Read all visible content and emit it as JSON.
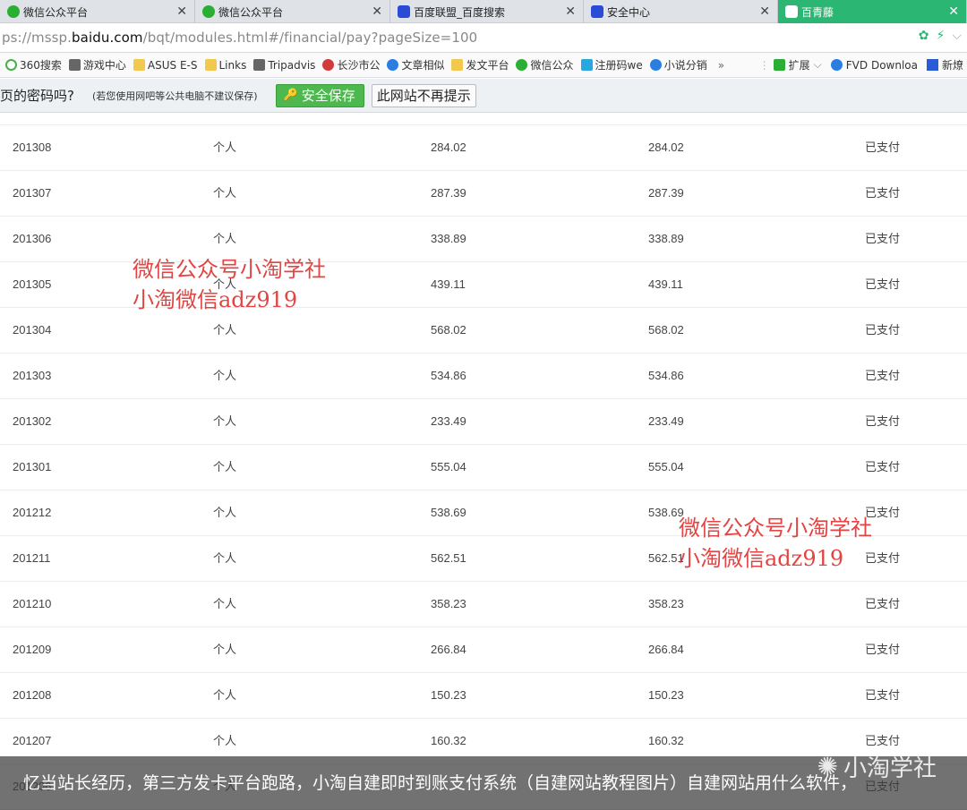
{
  "tabs": [
    {
      "label": "微信公众平台",
      "icon": "wechat-icon",
      "active": false
    },
    {
      "label": "微信公众平台",
      "icon": "wechat-icon",
      "active": false
    },
    {
      "label": "百度联盟_百度搜索",
      "icon": "baidu-paw-icon",
      "active": false
    },
    {
      "label": "安全中心",
      "icon": "baidu-paw-icon",
      "active": false
    },
    {
      "label": "百青藤",
      "icon": "baidu-paw-icon",
      "active": true
    }
  ],
  "address": {
    "prefix": "ps://mssp.",
    "domain": "baidu.com",
    "path": "/bqt/modules.html#/financial/pay?pageSize=100"
  },
  "bookmarks": [
    {
      "label": "360搜索",
      "icon": "ring"
    },
    {
      "label": "游戏中心",
      "icon": "gray"
    },
    {
      "label": "ASUS E-S",
      "icon": "folder"
    },
    {
      "label": "Links",
      "icon": "folder"
    },
    {
      "label": "Tripadvis",
      "icon": "gray"
    },
    {
      "label": "长沙市公",
      "icon": "red"
    },
    {
      "label": "文章相似",
      "icon": "blue"
    },
    {
      "label": "发文平台",
      "icon": "folder"
    },
    {
      "label": "微信公众",
      "icon": "green"
    },
    {
      "label": "注册码we",
      "icon": "cyan"
    },
    {
      "label": "小说分销",
      "icon": "blue"
    }
  ],
  "bookmarks_more": "»",
  "bookmarks_right": {
    "extensions": "扩展",
    "fvd": "FVD Downloa",
    "new": "新燎"
  },
  "password_bar": {
    "question": "页的密码吗?",
    "note": "(若您使用网吧等公共电脑不建议保存)",
    "save_label": "安全保存",
    "never_label": "此网站不再提示"
  },
  "table": {
    "rows": [
      {
        "period": "201308",
        "type": "个人",
        "amount": "284.02",
        "paid": "284.02",
        "status": "已支付"
      },
      {
        "period": "201307",
        "type": "个人",
        "amount": "287.39",
        "paid": "287.39",
        "status": "已支付"
      },
      {
        "period": "201306",
        "type": "个人",
        "amount": "338.89",
        "paid": "338.89",
        "status": "已支付"
      },
      {
        "period": "201305",
        "type": "个人",
        "amount": "439.11",
        "paid": "439.11",
        "status": "已支付"
      },
      {
        "period": "201304",
        "type": "个人",
        "amount": "568.02",
        "paid": "568.02",
        "status": "已支付"
      },
      {
        "period": "201303",
        "type": "个人",
        "amount": "534.86",
        "paid": "534.86",
        "status": "已支付"
      },
      {
        "period": "201302",
        "type": "个人",
        "amount": "233.49",
        "paid": "233.49",
        "status": "已支付"
      },
      {
        "period": "201301",
        "type": "个人",
        "amount": "555.04",
        "paid": "555.04",
        "status": "已支付"
      },
      {
        "period": "201212",
        "type": "个人",
        "amount": "538.69",
        "paid": "538.69",
        "status": "已支付"
      },
      {
        "period": "201211",
        "type": "个人",
        "amount": "562.51",
        "paid": "562.51",
        "status": "已支付"
      },
      {
        "period": "201210",
        "type": "个人",
        "amount": "358.23",
        "paid": "358.23",
        "status": "已支付"
      },
      {
        "period": "201209",
        "type": "个人",
        "amount": "266.84",
        "paid": "266.84",
        "status": "已支付"
      },
      {
        "period": "201208",
        "type": "个人",
        "amount": "150.23",
        "paid": "150.23",
        "status": "已支付"
      },
      {
        "period": "201207",
        "type": "个人",
        "amount": "160.32",
        "paid": "160.32",
        "status": "已支付"
      },
      {
        "period": "201206",
        "type": "个人",
        "amount": "",
        "paid": "",
        "status": "已支付"
      }
    ]
  },
  "watermark": {
    "line1": "微信公众号小淘学社",
    "line2": "小淘微信adz919"
  },
  "caption": "忆当站长经历，第三方发卡平台跑路，小淘自建即时到账支付系统（自建网站教程图片）自建网站用什么软件，",
  "logo": "小淘学社",
  "colors": {
    "accent": "#2bb673",
    "save_button": "#4cb84e",
    "watermark": "#e0302e"
  }
}
